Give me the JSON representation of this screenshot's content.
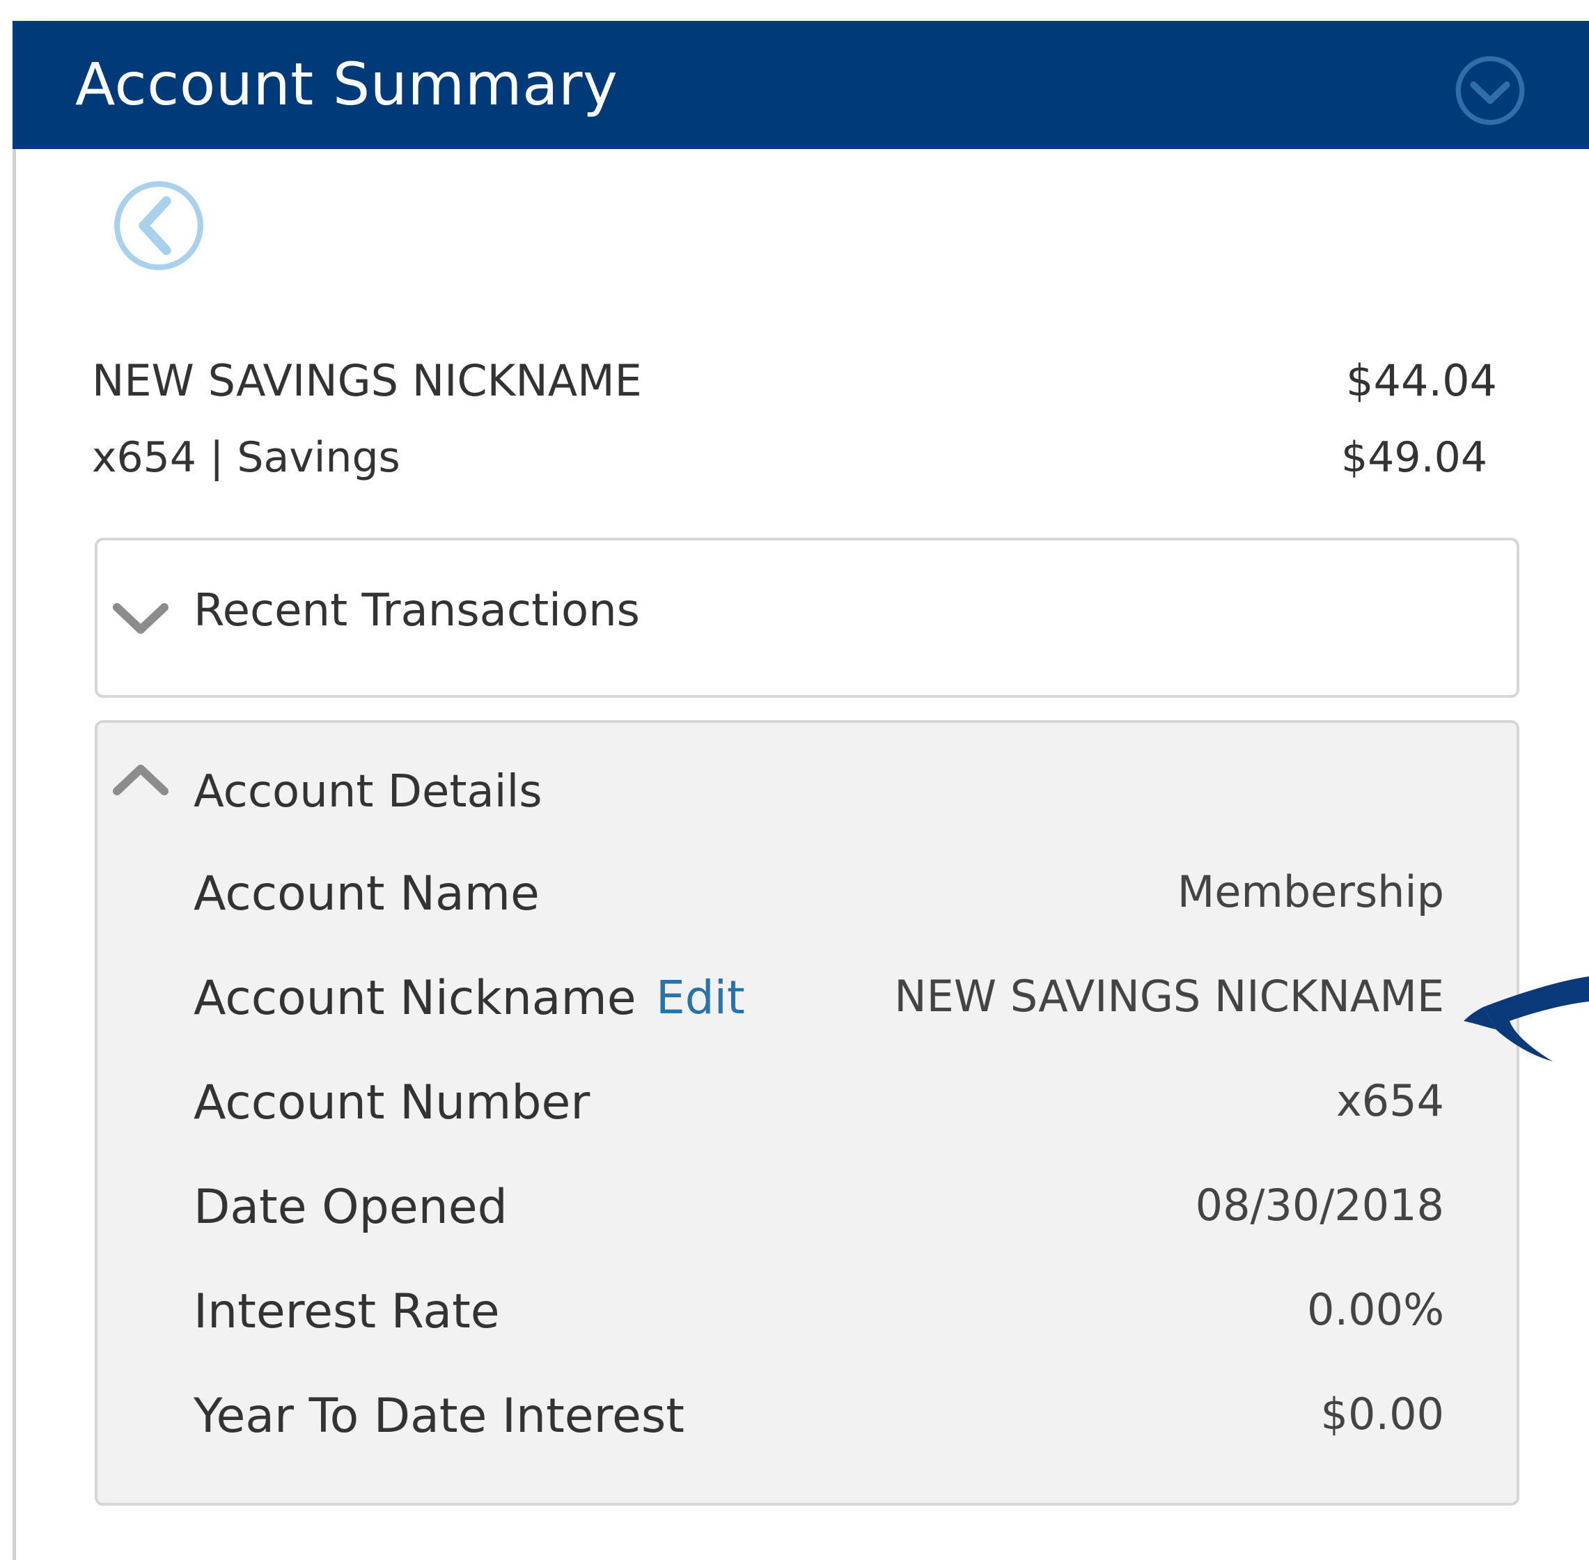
{
  "header": {
    "title": "Account Summary",
    "toggle_icon": "chevron-down-circle-icon",
    "background": "#003a78"
  },
  "nav": {
    "back_icon": "chevron-left-circle-icon"
  },
  "account": {
    "nickname": "NEW SAVINGS NICKNAME",
    "current_balance": "$44.04",
    "subtitle": "x654 | Savings",
    "available_balance": "$49.04"
  },
  "recent_transactions": {
    "title": "Recent Transactions",
    "state": "collapsed",
    "icon": "chevron-down-icon"
  },
  "account_details": {
    "title": "Account Details",
    "state": "expanded",
    "icon": "chevron-up-icon",
    "edit_label": "Edit",
    "rows": [
      {
        "label": "Account Name",
        "value": "Membership"
      },
      {
        "label": "Account Nickname",
        "value": "NEW SAVINGS NICKNAME"
      },
      {
        "label": "Account Number",
        "value": "x654"
      },
      {
        "label": "Date Opened",
        "value": "08/30/2018"
      },
      {
        "label": "Interest Rate",
        "value": "0.00%"
      },
      {
        "label": "Year To Date Interest",
        "value": "$0.00"
      }
    ]
  },
  "annotation": {
    "icon": "pointer-arrow-icon",
    "color": "#0b3a7a"
  }
}
